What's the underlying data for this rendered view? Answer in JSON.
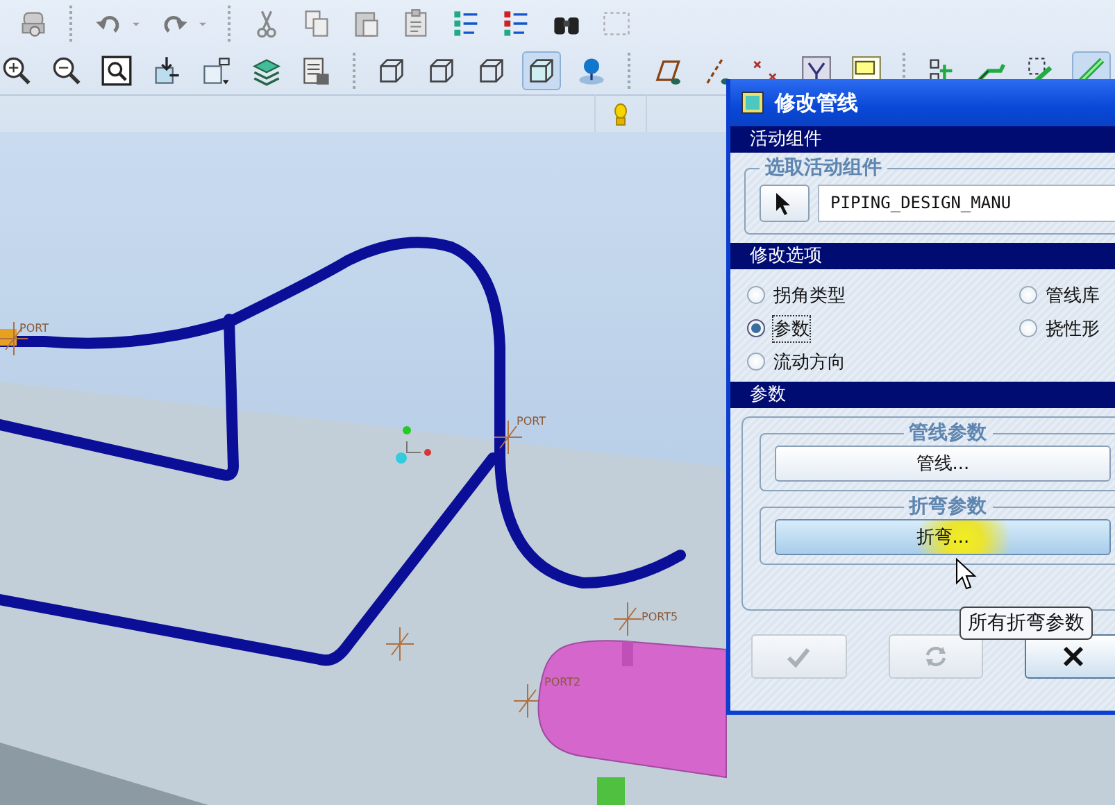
{
  "viewport": {
    "port_labels": [
      "PORT",
      "PORT",
      "PORT2",
      "PORT5"
    ]
  },
  "dialog": {
    "title": "修改管线",
    "active_component": {
      "heading": "活动组件",
      "group_label": "选取活动组件",
      "value": "PIPING_DESIGN_MANU"
    },
    "modify_options": {
      "heading": "修改选项",
      "options": [
        {
          "label": "拐角类型",
          "selected": false
        },
        {
          "label": "管线库",
          "selected": false
        },
        {
          "label": "参数",
          "selected": true
        },
        {
          "label": "挠性形",
          "selected": false
        },
        {
          "label": "流动方向",
          "selected": false
        }
      ]
    },
    "parameters": {
      "heading": "参数",
      "groups": [
        {
          "label": "管线参数",
          "button": "管线...",
          "hovered": false
        },
        {
          "label": "折弯参数",
          "button": "折弯...",
          "hovered": true
        }
      ]
    },
    "tooltip": "所有折弯参数",
    "footer_buttons": [
      {
        "kind": "ok",
        "disabled": true
      },
      {
        "kind": "repeat",
        "disabled": true
      },
      {
        "kind": "cancel",
        "disabled": false
      }
    ]
  }
}
